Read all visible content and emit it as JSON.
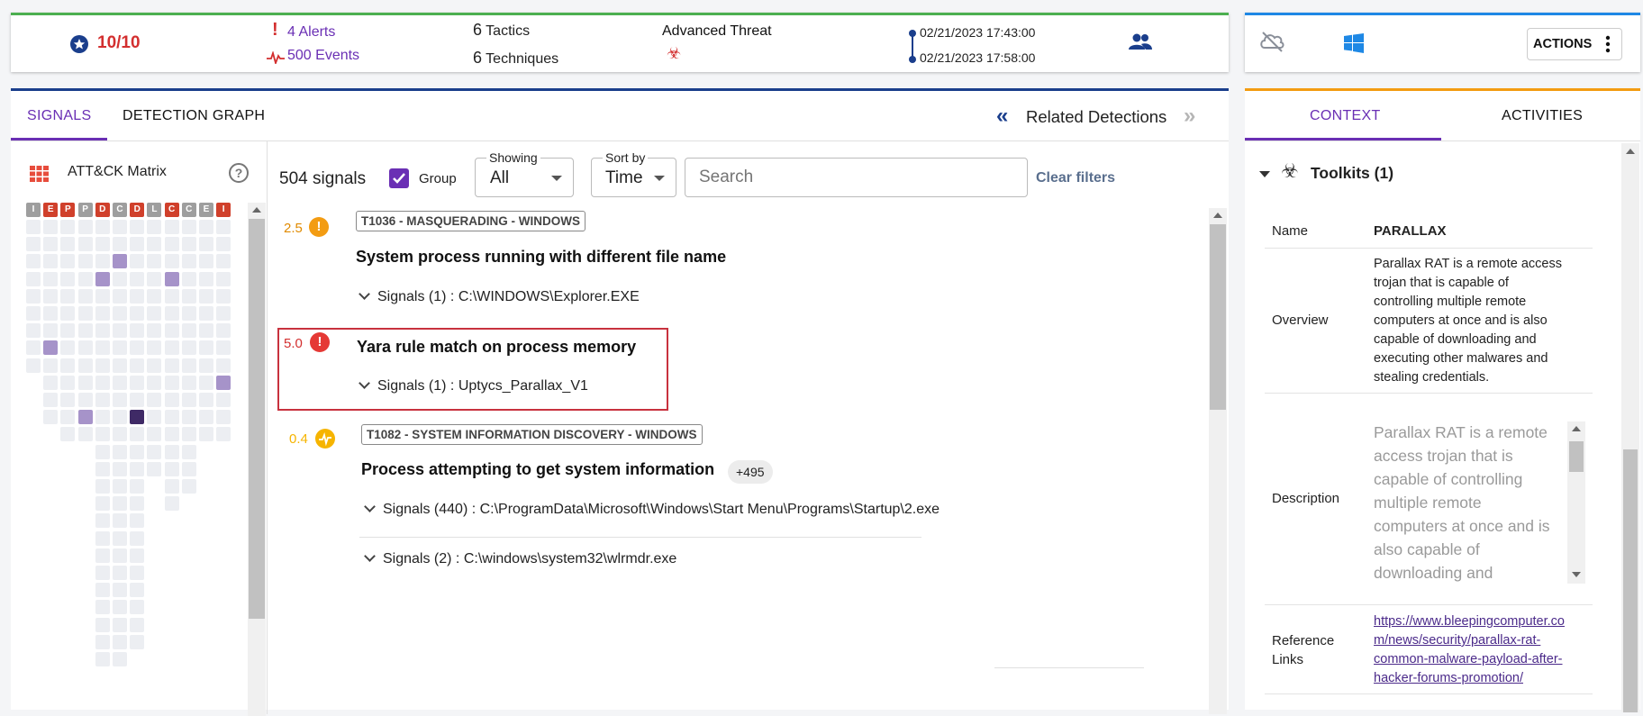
{
  "header": {
    "score": "10/10",
    "alerts": "4 Alerts",
    "events": "500 Events",
    "tactics_count": "6",
    "tactics_label": "Tactics",
    "techniques_count": "6",
    "techniques_label": "Techniques",
    "threat_label": "Advanced Threat",
    "time_start": "02/21/2023 17:43:00",
    "time_end": "02/21/2023 17:58:00",
    "actions_label": "ACTIONS"
  },
  "tabs": {
    "signals": "SIGNALS",
    "detection_graph": "DETECTION GRAPH",
    "related_detections": "Related Detections",
    "context": "CONTEXT",
    "activities": "ACTIVITIES"
  },
  "matrix": {
    "title": "ATT&CK Matrix",
    "columns": [
      "I",
      "E",
      "P",
      "P",
      "D",
      "C",
      "D",
      "L",
      "C",
      "C",
      "E",
      "I"
    ]
  },
  "filters": {
    "count": "504 signals",
    "group_label": "Group",
    "showing_label": "Showing",
    "showing_value": "All",
    "sort_label": "Sort by",
    "sort_value": "Time",
    "search_placeholder": "Search",
    "clear_filters": "Clear filters"
  },
  "detections": [
    {
      "score": "2.5",
      "tag": "T1036 - MASQUERADING - WINDOWS",
      "title": "System process running with different file name",
      "signals": [
        "Signals (1) : C:\\WINDOWS\\Explorer.EXE"
      ]
    },
    {
      "score": "5.0",
      "tag": "",
      "title": "Yara rule match on process memory",
      "signals": [
        "Signals (1) : Uptycs_Parallax_V1"
      ]
    },
    {
      "score": "0.4",
      "tag": "T1082 - SYSTEM INFORMATION DISCOVERY - WINDOWS",
      "title": "Process attempting to get system information",
      "extra": "+495",
      "signals": [
        "Signals (440) : C:\\ProgramData\\Microsoft\\Windows\\Start Menu\\Programs\\Startup\\2.exe",
        "Signals (2) : C:\\windows\\system32\\wlrmdr.exe"
      ]
    }
  ],
  "context": {
    "section_title": "Toolkits (1)",
    "name_label": "Name",
    "name_value": "PARALLAX",
    "overview_label": "Overview",
    "overview_lines": [
      "Parallax RAT is a remote access",
      "trojan that is capable of",
      "controlling multiple remote",
      "computers at once and is also",
      "capable of downloading and",
      "executing other malwares and",
      "stealing credentials."
    ],
    "description_label": "Description",
    "description_lines": [
      "Parallax RAT is a remote",
      "access trojan that is",
      "capable of controlling",
      "multiple remote",
      "computers at once and is",
      "also capable of",
      "downloading and"
    ],
    "ref_label_1": "Reference",
    "ref_label_2": "Links",
    "ref_lines": [
      "https://www.bleepingcomputer.co",
      "m/news/security/parallax-rat-",
      "common-malware-payload-after-",
      "hacker-forums-promotion/"
    ]
  },
  "colors": {
    "accent_purple": "#6a2fb4",
    "danger_red": "#d32f2f",
    "warn_orange": "#f39c12",
    "warn_amber": "#f6b400",
    "nav_blue": "#1a3e8c"
  }
}
